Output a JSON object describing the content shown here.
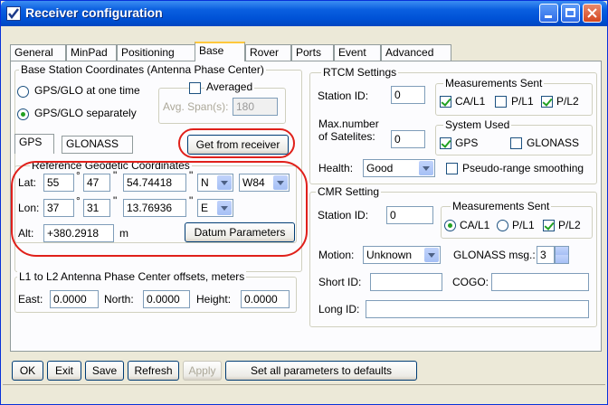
{
  "window": {
    "title": "Receiver configuration"
  },
  "tabs": [
    "General",
    "MinPad",
    "Positioning",
    "Base",
    "Rover",
    "Ports",
    "Event",
    "Advanced"
  ],
  "active_tab": "Base",
  "base_station": {
    "group_label": "Base Station Coordinates (Antenna Phase Center)",
    "radio_one_time": "GPS/GLO at one time",
    "radio_separately": "GPS/GLO separately",
    "averaged_label": "Averaged",
    "avg_span_label": "Avg. Span(s):",
    "avg_span_value": "180",
    "subtab_gps": "GPS",
    "subtab_glonass": "GLONASS",
    "get_from_receiver": "Get from receiver"
  },
  "geodetic": {
    "group_label": "Reference Geodetic Coordinates",
    "lat_label": "Lat:",
    "lat_deg": "55",
    "lat_min": "47",
    "lat_sec": "54.74418",
    "lat_hem": "N",
    "datum": "W84",
    "lon_label": "Lon:",
    "lon_deg": "37",
    "lon_min": "31",
    "lon_sec": "13.76936",
    "lon_hem": "E",
    "alt_label": "Alt:",
    "alt_value": "+380.2918",
    "alt_unit": "m",
    "datum_button": "Datum Parameters",
    "deg_symbol": "°",
    "sec_symbol": "\""
  },
  "offsets": {
    "group_label": "L1 to L2 Antenna Phase Center offsets, meters",
    "east_label": "East:",
    "east_value": "0.0000",
    "north_label": "North:",
    "north_value": "0.0000",
    "height_label": "Height:",
    "height_value": "0.0000"
  },
  "rtcm": {
    "group_label": "RTCM Settings",
    "station_id_label": "Station ID:",
    "station_id": "0",
    "max_sat_label_1": "Max.number",
    "max_sat_label_2": "of Satelites:",
    "max_sat": "0",
    "health_label": "Health:",
    "health": "Good",
    "pseudo_range": "Pseudo-range smoothing",
    "meas_sent_label": "Measurements Sent",
    "ca_l1": "CA/L1",
    "p_l1": "P/L1",
    "p_l2": "P/L2",
    "sys_used_label": "System Used",
    "gps": "GPS",
    "glonass": "GLONASS"
  },
  "cmr": {
    "group_label": "CMR Setting",
    "station_id_label": "Station ID:",
    "station_id": "0",
    "meas_sent_label": "Measurements Sent",
    "ca_l1": "CA/L1",
    "p_l1": "P/L1",
    "p_l2": "P/L2",
    "motion_label": "Motion:",
    "motion": "Unknown",
    "glonass_msg_label": "GLONASS msg.:",
    "glonass_msg": "3",
    "short_id_label": "Short ID:",
    "cogo_label": "COGO:",
    "long_id_label": "Long ID:"
  },
  "buttons": {
    "ok": "OK",
    "exit": "Exit",
    "save": "Save",
    "refresh": "Refresh",
    "apply": "Apply",
    "defaults": "Set all parameters to defaults"
  },
  "colors": {
    "highlight": "#e0201a",
    "title_bar": "#0a5fe0"
  }
}
